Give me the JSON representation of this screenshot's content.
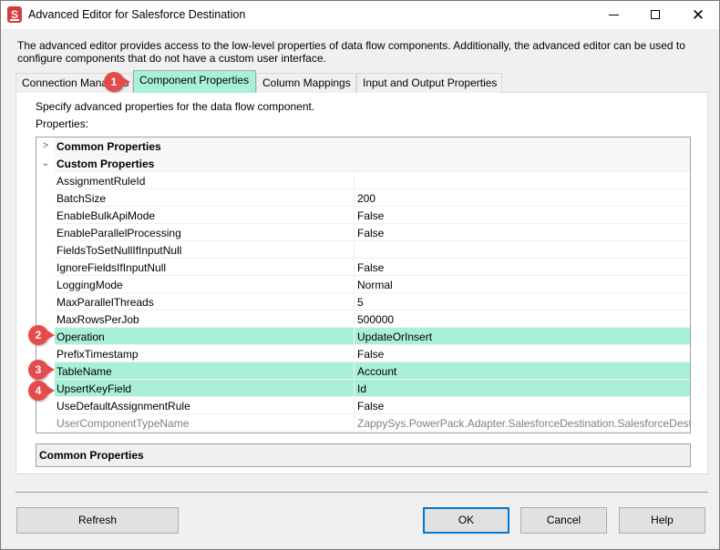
{
  "window": {
    "title": "Advanced Editor for Salesforce Destination",
    "icon": "salesforce-destination-icon",
    "controls": {
      "minimize": "minimize-icon",
      "maximize": "maximize-icon",
      "close": "close-icon"
    }
  },
  "description": "The advanced editor provides access to the low-level properties of data flow components. Additionally, the advanced editor can be used to configure components that do not have a custom user interface.",
  "tabs": [
    {
      "label": "Connection Managers",
      "active": false
    },
    {
      "label": "Component Properties",
      "active": true
    },
    {
      "label": "Column Mappings",
      "active": false
    },
    {
      "label": "Input and Output Properties",
      "active": false
    }
  ],
  "page": {
    "instruction": "Specify advanced properties for the data flow component.",
    "properties_label": "Properties:"
  },
  "grid": {
    "categories": [
      {
        "label": "Common Properties",
        "expanded": false
      },
      {
        "label": "Custom Properties",
        "expanded": true
      }
    ],
    "rows": [
      {
        "name": "AssignmentRuleId",
        "value": ""
      },
      {
        "name": "BatchSize",
        "value": "200"
      },
      {
        "name": "EnableBulkApiMode",
        "value": "False"
      },
      {
        "name": "EnableParallelProcessing",
        "value": "False"
      },
      {
        "name": "FieldsToSetNullIfInputNull",
        "value": ""
      },
      {
        "name": "IgnoreFieldsIfInputNull",
        "value": "False"
      },
      {
        "name": "LoggingMode",
        "value": "Normal"
      },
      {
        "name": "MaxParallelThreads",
        "value": "5"
      },
      {
        "name": "MaxRowsPerJob",
        "value": "500000"
      },
      {
        "name": "Operation",
        "value": "UpdateOrInsert"
      },
      {
        "name": "PrefixTimestamp",
        "value": "False"
      },
      {
        "name": "TableName",
        "value": "Account"
      },
      {
        "name": "UpsertKeyField",
        "value": "Id"
      },
      {
        "name": "UseDefaultAssignmentRule",
        "value": "False"
      },
      {
        "name": "UserComponentTypeName",
        "value": "ZappySys.PowerPack.Adapter.SalesforceDestination.SalesforceDestination"
      }
    ]
  },
  "help": {
    "title": "Common Properties"
  },
  "buttons": {
    "refresh": "Refresh",
    "ok": "OK",
    "cancel": "Cancel",
    "help": "Help"
  },
  "badges": [
    "1",
    "2",
    "3",
    "4"
  ],
  "colors": {
    "highlight": "#aaf0d8",
    "badge": "#e54b4b",
    "default_button_border": "#0078d7"
  }
}
